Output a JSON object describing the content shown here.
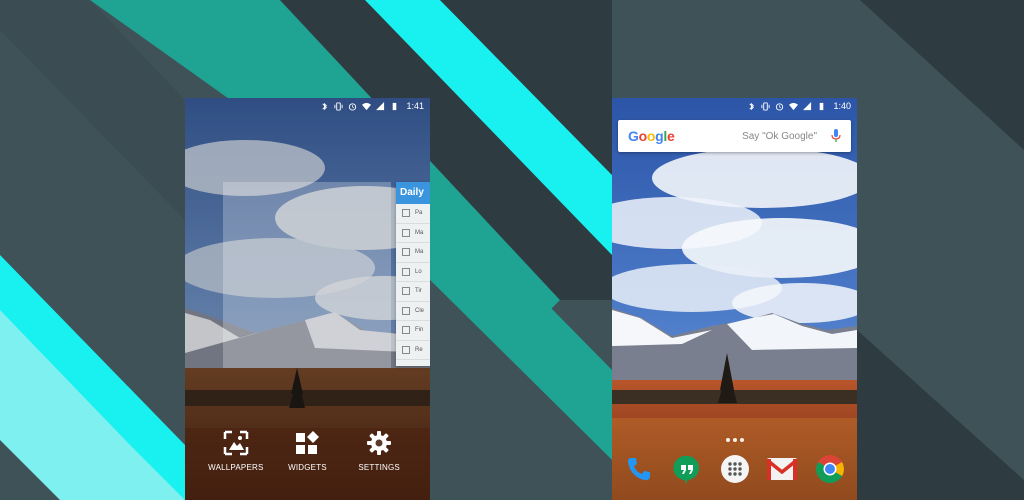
{
  "background": {
    "colors": {
      "dark": "#2e3c41",
      "slate": "#3f5258",
      "teal": "#1fa393",
      "cyan": "#19f0f0",
      "light_cyan": "#7ff0f0"
    }
  },
  "left_phone": {
    "status": {
      "time": "1:41",
      "icons": [
        "bluetooth-icon",
        "vibrate-icon",
        "alarm-icon",
        "wifi-icon",
        "signal-icon",
        "battery-icon"
      ]
    },
    "widget": {
      "title": "Daily",
      "tasks": [
        "Pa",
        "Ma",
        "Ma",
        "Lo",
        "Tir",
        "Cle",
        "Fin",
        "Re"
      ]
    },
    "overview_menu": [
      {
        "label": "WALLPAPERS",
        "icon": "wallpapers-icon"
      },
      {
        "label": "WIDGETS",
        "icon": "widgets-icon"
      },
      {
        "label": "SETTINGS",
        "icon": "settings-gear-icon"
      }
    ]
  },
  "right_phone": {
    "status": {
      "time": "1:40",
      "icons": [
        "bluetooth-icon",
        "vibrate-icon",
        "alarm-icon",
        "wifi-icon",
        "signal-icon",
        "battery-icon"
      ]
    },
    "search": {
      "logo": "Google",
      "hint": "Say \"Ok Google\""
    },
    "dock": [
      "phone-icon",
      "hangouts-icon",
      "app-drawer-icon",
      "gmail-icon",
      "chrome-icon"
    ]
  }
}
